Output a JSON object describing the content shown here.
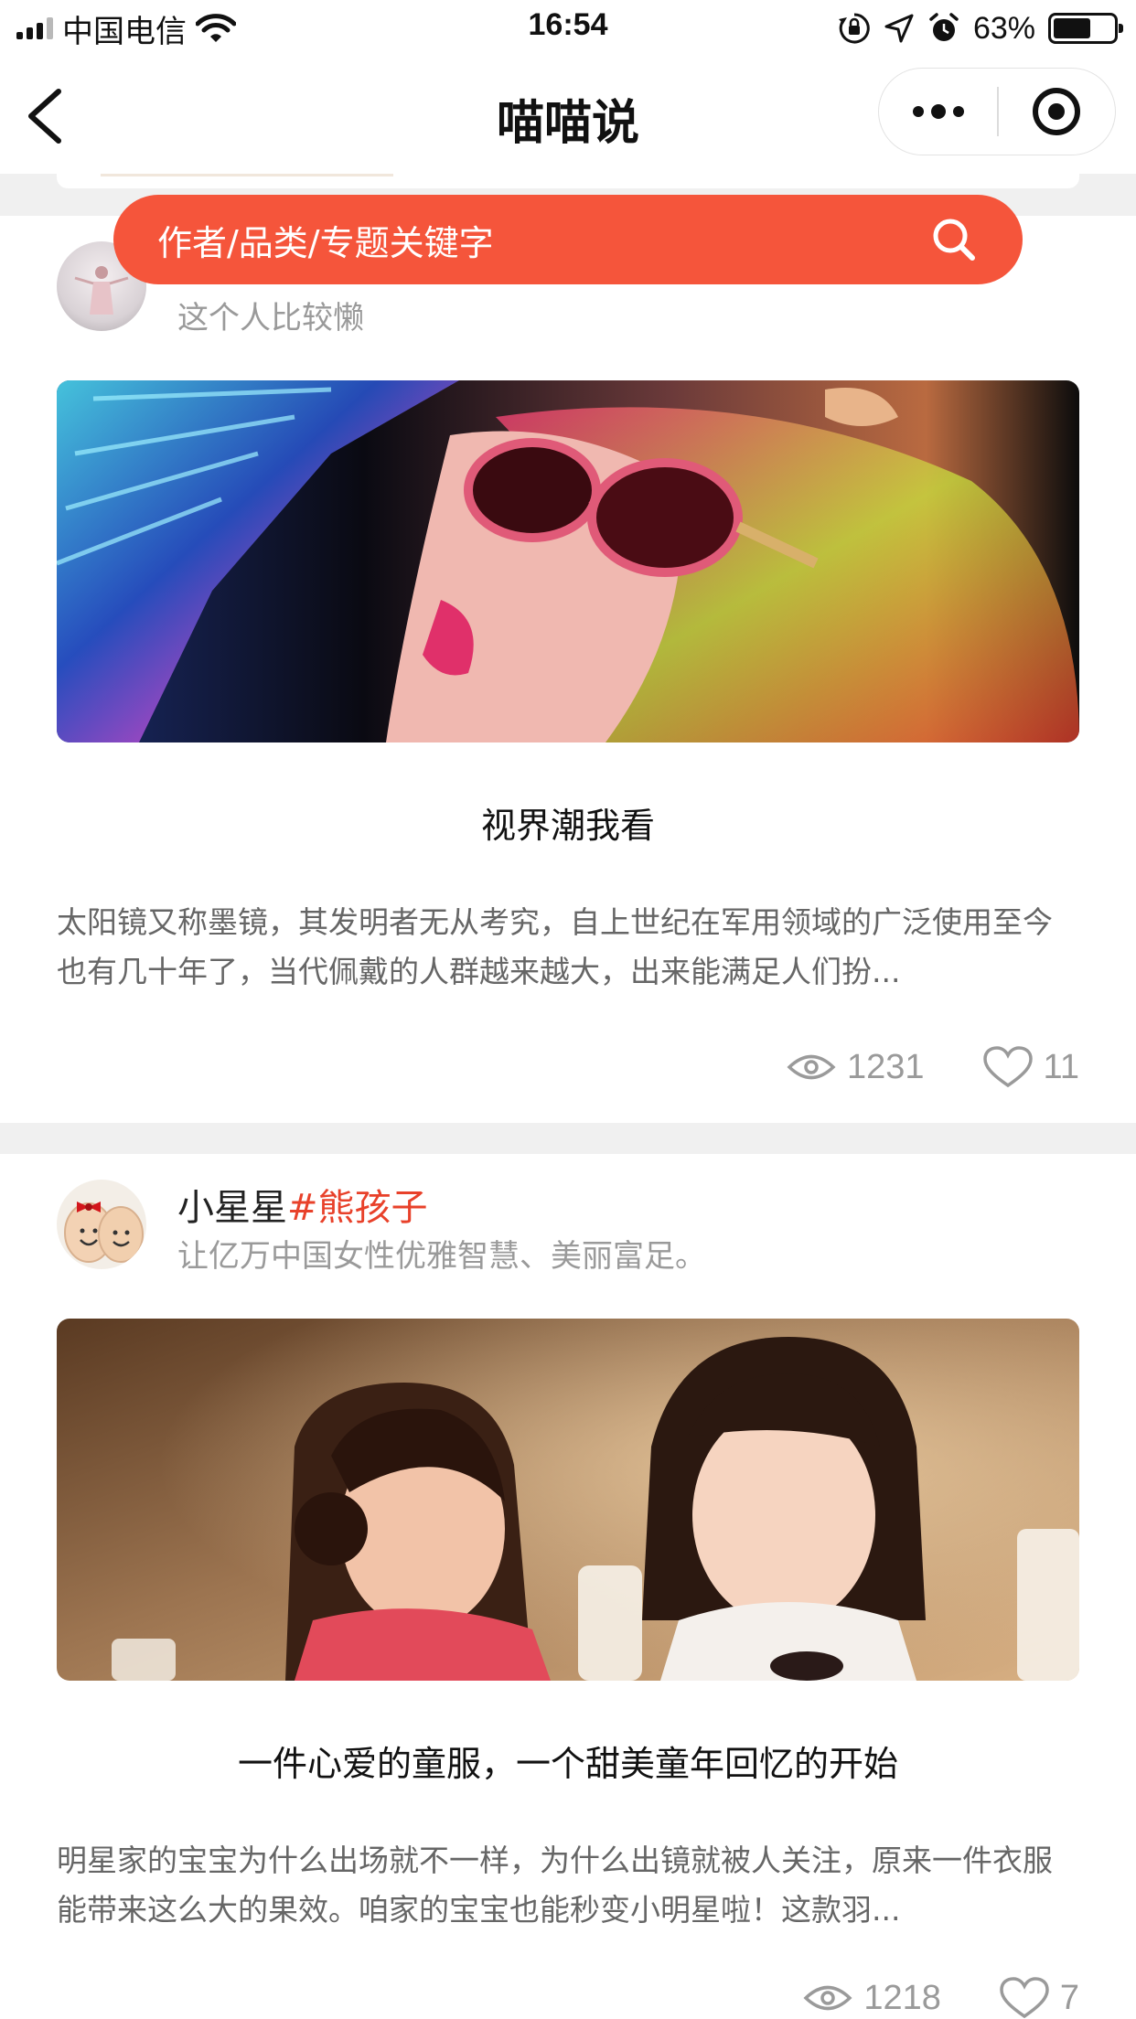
{
  "status_bar": {
    "carrier": "中国电信",
    "time": "16:54",
    "battery_percent": "63%",
    "battery_level": 0.63,
    "icons": [
      "signal-icon",
      "wifi-icon",
      "orientation-lock-icon",
      "location-icon",
      "alarm-icon",
      "battery-icon"
    ]
  },
  "nav": {
    "title": "喵喵说",
    "back_icon": "chevron-left-icon",
    "more_icon": "more-dots-icon",
    "close_icon": "target-close-icon"
  },
  "search": {
    "placeholder": "作者/品类/专题关键字",
    "icon": "search-icon",
    "color": "#f5553b"
  },
  "articles": [
    {
      "author_name": "",
      "author_tag": "",
      "author_desc": "这个人比较懒",
      "title": "视界潮我看",
      "summary": "太阳镜又称墨镜，其发明者无从考究，自上世纪在军用领域的广泛使用至今也有几十年了，当代佩戴的人群越来越大，出来能满足人们扮...",
      "views": "1231",
      "likes": "11"
    },
    {
      "author_name": "小星星",
      "author_tag": "#熊孩子",
      "author_desc": "让亿万中国女性优雅智慧、美丽富足。",
      "title": "一件心爱的童服，一个甜美童年回忆的开始",
      "summary": "明星家的宝宝为什么出场就不一样，为什么出镜就被人关注，原来一件衣服能带来这么大的果效。咱家的宝宝也能秒变小明星啦！这款羽...",
      "views": "1218",
      "likes": "7"
    }
  ],
  "colors": {
    "accent": "#f5553b",
    "tag": "#e8412a",
    "separator": "#f0f0f0",
    "muted_text": "#9a9a9a"
  }
}
